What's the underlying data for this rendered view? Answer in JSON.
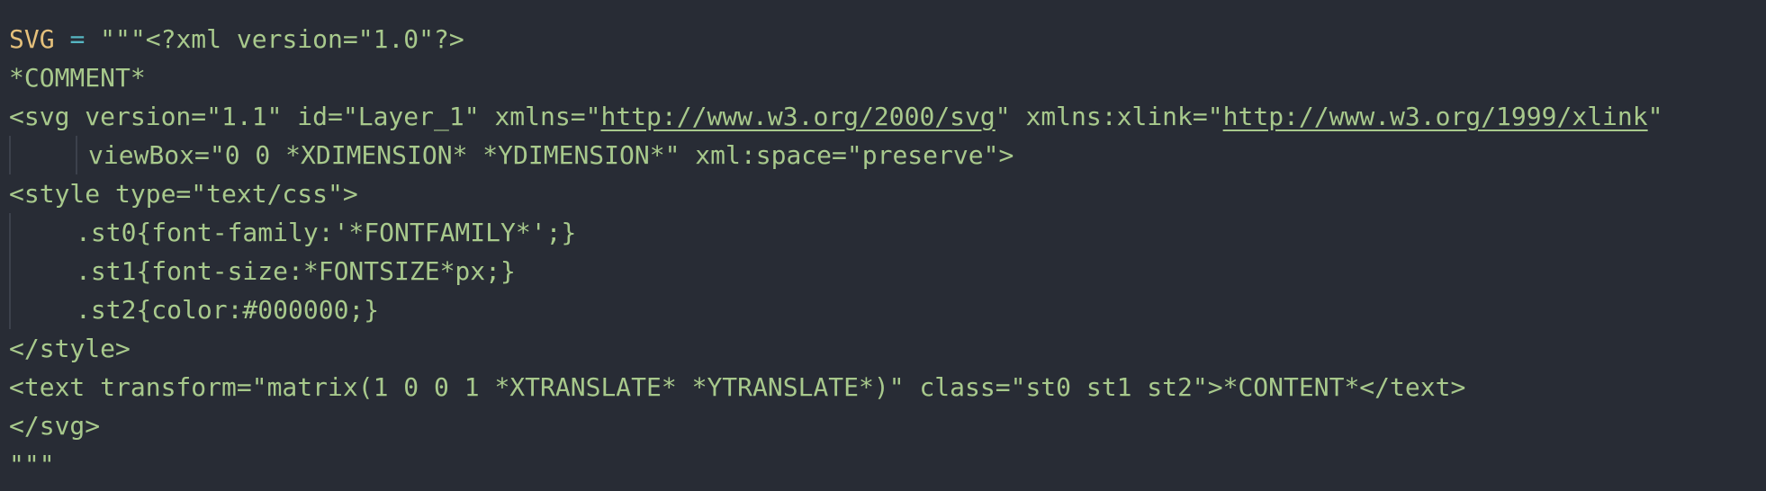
{
  "editor": {
    "background": "#282c35",
    "colors": {
      "string": "#a8c98c",
      "variable": "#e5c07b",
      "operator": "#56b6c2",
      "guide": "#3c414c"
    },
    "line1": {
      "var": "SVG",
      "op": "=",
      "text": " \"\"\"<?xml version=\"1.0\"?>"
    },
    "line2": {
      "text": "*COMMENT*"
    },
    "line3": {
      "p1": "<svg version=\"1.1\" id=\"Layer_1\" xmlns=\"",
      "url1": "http://www.w3.org/2000/svg",
      "p2": "\" xmlns:xlink=\"",
      "url2": "http://www.w3.org/1999/xlink",
      "p3": "\""
    },
    "line4": {
      "text": "viewBox=\"0 0 *XDIMENSION* *YDIMENSION*\" xml:space=\"preserve\">"
    },
    "line5": {
      "text": "<style type=\"text/css\">"
    },
    "line6": {
      "text": ".st0{font-family:'*FONTFAMILY*';}"
    },
    "line7": {
      "text": ".st1{font-size:*FONTSIZE*px;}"
    },
    "line8": {
      "text": ".st2{color:#000000;}"
    },
    "line9": {
      "text": "</style>"
    },
    "line10": {
      "text": "<text transform=\"matrix(1 0 0 1 *XTRANSLATE* *YTRANSLATE*)\" class=\"st0 st1 st2\">*CONTENT*</text>"
    },
    "line11": {
      "text": "</svg>"
    },
    "line12": {
      "text": "\"\"\""
    }
  }
}
